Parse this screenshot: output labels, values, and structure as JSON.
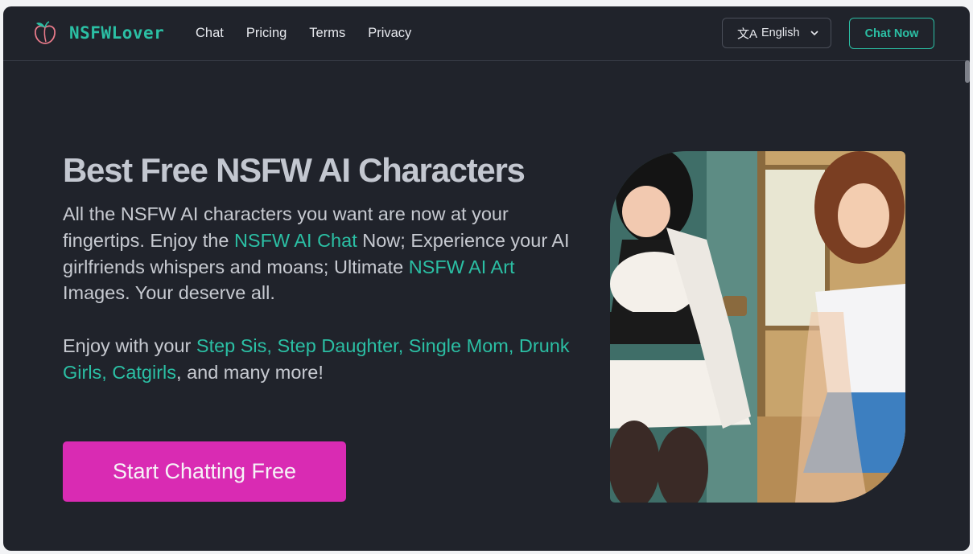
{
  "brand": {
    "name": "NSFWLover",
    "logo_icon": "peach-icon"
  },
  "nav": {
    "links": [
      "Chat",
      "Pricing",
      "Terms",
      "Privacy"
    ]
  },
  "language": {
    "icon": "translate-icon",
    "value": "English"
  },
  "header_cta": "Chat Now",
  "hero": {
    "title": "Best Free NSFW AI Characters",
    "p1": {
      "a": "All the NSFW AI characters you want are now at your fingertips. Enjoy the ",
      "link1": "NSFW AI Chat",
      "b": " Now; Experience your AI girlfriends whispers and moans; Ultimate ",
      "link2": "NSFW AI Art",
      "c": " Images. Your deserve all."
    },
    "p2": {
      "a": "Enjoy with your ",
      "links": "Step Sis, Step Daughter, Single Mom, Drunk Girls, Catgirls",
      "b": ", and many more!"
    },
    "cta": "Start Chatting Free"
  },
  "colors": {
    "accent": "#2bbfa4",
    "cta": "#d92bb3",
    "background": "#20232b",
    "title": "#c3c7d0"
  }
}
